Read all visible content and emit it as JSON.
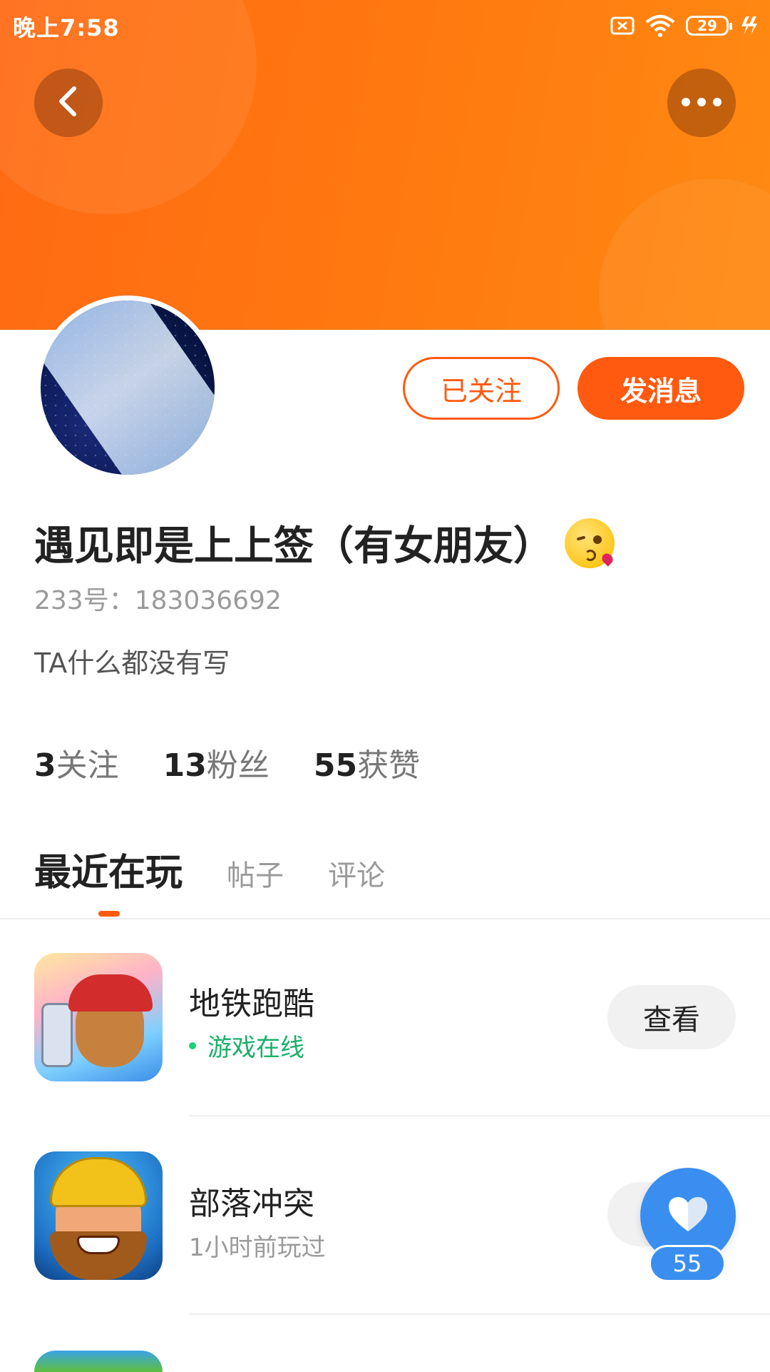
{
  "status_bar": {
    "time": "晚上7:58",
    "battery": "29"
  },
  "header": {
    "back_icon": "chevron-left-icon",
    "more_icon": "more-horizontal-icon"
  },
  "profile": {
    "follow_button": "已关注",
    "message_button": "发消息",
    "username": "遇见即是上上签（有女朋友）",
    "uid": "233号：183036692",
    "bio": "TA什么都没有写",
    "stats": [
      {
        "value": "3",
        "label": "关注"
      },
      {
        "value": "13",
        "label": "粉丝"
      },
      {
        "value": "55",
        "label": "获赞"
      }
    ]
  },
  "tabs": [
    {
      "label": "最近在玩",
      "active": true
    },
    {
      "label": "帖子",
      "active": false
    },
    {
      "label": "评论",
      "active": false
    }
  ],
  "games": [
    {
      "name": "地铁跑酷",
      "status": "游戏在线",
      "action": "查看"
    },
    {
      "name": "部落冲突",
      "status": "1小时前玩过",
      "action": ""
    }
  ],
  "like_fab": {
    "count": "55"
  },
  "colors": {
    "brand_orange": "#ff5a10",
    "online_green": "#1bb06a",
    "like_blue": "#3a8ef0"
  }
}
